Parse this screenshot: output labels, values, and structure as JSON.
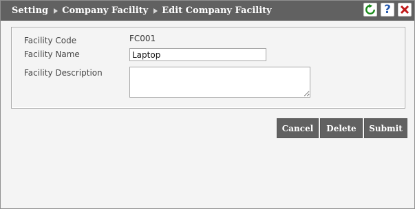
{
  "breadcrumb": {
    "items": [
      "Setting",
      "Company Facility",
      "Edit Company Facility"
    ]
  },
  "toolbar": {
    "icons": [
      "refresh-icon",
      "help-icon",
      "close-icon"
    ],
    "help_glyph": "?",
    "colors": {
      "refresh": "#1a8a1a",
      "help": "#2a5db0",
      "close": "#c01818"
    }
  },
  "form": {
    "facility_code_label": "Facility Code",
    "facility_code_value": "FC001",
    "facility_name_label": "Facility Name",
    "facility_name_value": "Laptop",
    "facility_description_label": "Facility Description",
    "facility_description_value": ""
  },
  "actions": {
    "cancel_label": "Cancel",
    "delete_label": "Delete",
    "submit_label": "Submit"
  },
  "theme": {
    "header_bg": "#616161",
    "button_bg": "#616161",
    "page_bg": "#f4f4f4"
  }
}
